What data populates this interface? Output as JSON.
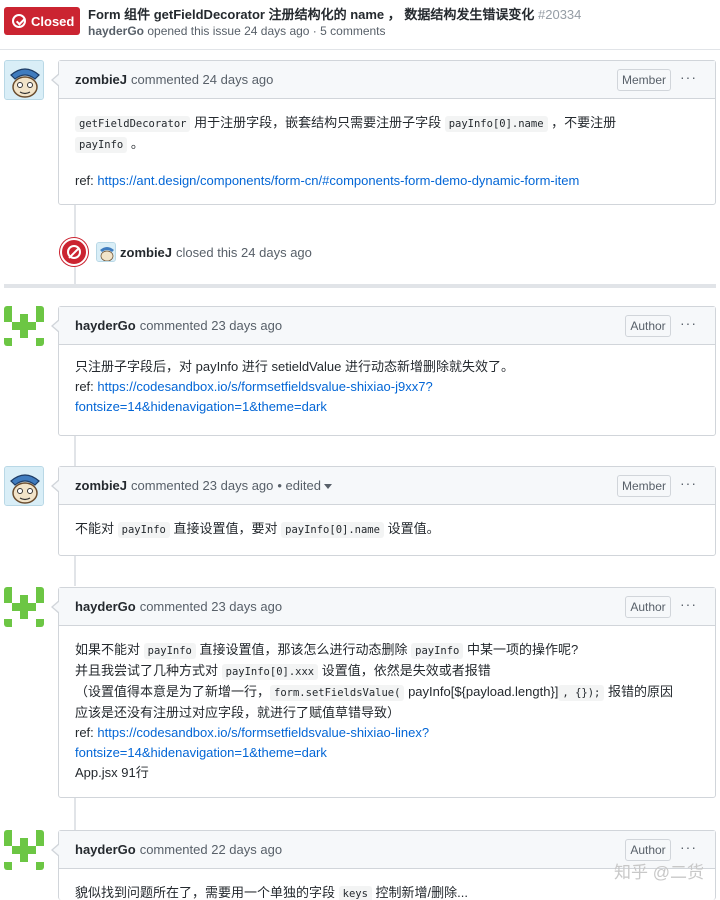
{
  "header": {
    "state": "Closed",
    "title": "Form 组件 getFieldDecorator 注册结构化的 name ， 数据结构发生错误变化",
    "number": "#20334",
    "author": "hayderGo",
    "meta": "opened this issue 24 days ago · 5 comments"
  },
  "comments": [
    {
      "author": "zombieJ",
      "action": "commented 24 days ago",
      "role": "Member",
      "body": {
        "line1": [
          "getFieldDecorator",
          " 用于注册字段，嵌套结构只需要注册子字段 ",
          "payInfo[0].name",
          " ，不要注册"
        ],
        "line2_code": "payInfo",
        "line2_suffix": " 。",
        "ref_label": "ref: ",
        "ref_link": "https://ant.design/components/form-cn/#components-form-demo-dynamic-form-item"
      }
    },
    {
      "author": "hayderGo",
      "action": "commented 23 days ago",
      "role": "Author",
      "body": {
        "line1": "只注册子字段后，对 payInfo 进行 setieldValue 进行动态新增删除就失效了。",
        "ref_label": "ref: ",
        "ref_link_1": "https://codesandbox.io/s/formsetfieldsvalue-shixiao-j9xx7?",
        "ref_link_2": "fontsize=14&hidenavigation=1&theme=dark"
      }
    },
    {
      "author": "zombieJ",
      "action": "commented 23 days ago",
      "edited": "• edited",
      "role": "Member",
      "body": {
        "p1": "不能对 ",
        "code1": "payInfo",
        "p2": " 直接设置值，要对 ",
        "code2": "payInfo[0].name",
        "p3": " 设置值。"
      }
    },
    {
      "author": "hayderGo",
      "action": "commented 23 days ago",
      "role": "Author",
      "body": {
        "l1a": "如果不能对 ",
        "l1code1": "payInfo",
        "l1b": " 直接设置值，那该怎么进行动态删除 ",
        "l1code2": "payInfo",
        "l1c": " 中某一项的操作呢?",
        "l2a": "并且我尝试了几种方式对 ",
        "l2code": "payInfo[0].xxx",
        "l2b": " 设置值，依然是失效或者报错",
        "l3a": "（设置值得本意是为了新增一行，",
        "l3code": "form.setFieldsValue(",
        "l3b": " payInfo[${payload.length}]",
        "l3code2": ", {});",
        "l3c": " 报错的原因",
        "l4": "应该是还没有注册过对应字段，就进行了赋值草错导致）",
        "ref_label": "ref: ",
        "ref_link_1": "https://codesandbox.io/s/formsetfieldsvalue-shixiao-linex?",
        "ref_link_2": "fontsize=14&hidenavigation=1&theme=dark",
        "l5": "App.jsx 91行"
      }
    },
    {
      "author": "hayderGo",
      "action": "commented 22 days ago",
      "role": "Author",
      "body": {
        "p1": "貌似找到问题所在了，需要用一个单独的字段 ",
        "code1": "keys",
        "p2": " 控制新增/删除..."
      }
    }
  ],
  "event": {
    "author": "zombieJ",
    "action": "closed this 24 days ago"
  },
  "more_glyph": "···",
  "watermark": "知乎 @二货"
}
